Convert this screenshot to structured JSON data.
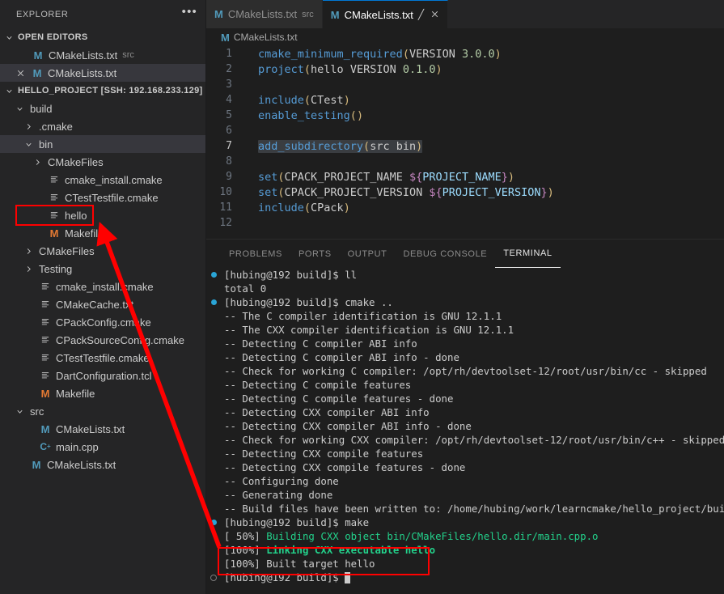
{
  "window": {
    "app": "Visual Studio Code",
    "theme_bg": "#1e1e1e",
    "accent": "#0078d4",
    "annotation_color": "#ff0000"
  },
  "sidebar": {
    "title": "EXPLORER",
    "more_actions": "•••",
    "open_editors": {
      "label": "OPEN EDITORS",
      "expanded": true,
      "items": [
        {
          "name": "CMakeLists.txt",
          "description": "src",
          "icon": "markdown-file-icon",
          "selected": false,
          "has_close": false
        },
        {
          "name": "CMakeLists.txt",
          "description": "",
          "icon": "markdown-file-icon",
          "selected": true,
          "has_close": true
        }
      ]
    },
    "workspace": {
      "label": "HELLO_PROJECT [SSH: 192.168.233.129]",
      "expanded": true,
      "tree": [
        {
          "name": "build",
          "type": "folder",
          "depth": 1,
          "expanded": true,
          "icon": "chevron-down-icon"
        },
        {
          "name": ".cmake",
          "type": "folder",
          "depth": 2,
          "expanded": false,
          "icon": "chevron-right-icon"
        },
        {
          "name": "bin",
          "type": "folder",
          "depth": 2,
          "expanded": true,
          "icon": "chevron-down-icon",
          "selected": true
        },
        {
          "name": "CMakeFiles",
          "type": "folder",
          "depth": 3,
          "expanded": false,
          "icon": "chevron-right-icon"
        },
        {
          "name": "cmake_install.cmake",
          "type": "file",
          "depth": 3,
          "icon": "config-file-icon"
        },
        {
          "name": "CTestTestfile.cmake",
          "type": "file",
          "depth": 3,
          "icon": "config-file-icon"
        },
        {
          "name": "hello",
          "type": "file",
          "depth": 3,
          "icon": "config-file-icon",
          "highlighted": true
        },
        {
          "name": "Makefile",
          "type": "file",
          "depth": 3,
          "icon": "makefile-icon"
        },
        {
          "name": "CMakeFiles",
          "type": "folder",
          "depth": 2,
          "expanded": false,
          "icon": "chevron-right-icon"
        },
        {
          "name": "Testing",
          "type": "folder",
          "depth": 2,
          "expanded": false,
          "icon": "chevron-right-icon"
        },
        {
          "name": "cmake_install.cmake",
          "type": "file",
          "depth": 2,
          "icon": "config-file-icon"
        },
        {
          "name": "CMakeCache.txt",
          "type": "file",
          "depth": 2,
          "icon": "config-file-icon"
        },
        {
          "name": "CPackConfig.cmake",
          "type": "file",
          "depth": 2,
          "icon": "config-file-icon"
        },
        {
          "name": "CPackSourceConfig.cmake",
          "type": "file",
          "depth": 2,
          "icon": "config-file-icon"
        },
        {
          "name": "CTestTestfile.cmake",
          "type": "file",
          "depth": 2,
          "icon": "config-file-icon"
        },
        {
          "name": "DartConfiguration.tcl",
          "type": "file",
          "depth": 2,
          "icon": "config-file-icon"
        },
        {
          "name": "Makefile",
          "type": "file",
          "depth": 2,
          "icon": "makefile-icon"
        },
        {
          "name": "src",
          "type": "folder",
          "depth": 1,
          "expanded": true,
          "icon": "chevron-down-icon"
        },
        {
          "name": "CMakeLists.txt",
          "type": "file",
          "depth": 2,
          "icon": "markdown-file-icon"
        },
        {
          "name": "main.cpp",
          "type": "file",
          "depth": 2,
          "icon": "cpp-file-icon"
        },
        {
          "name": "CMakeLists.txt",
          "type": "file",
          "depth": 1,
          "icon": "markdown-file-icon"
        }
      ]
    }
  },
  "editor": {
    "tabs": [
      {
        "label": "CMakeLists.txt",
        "description": "src",
        "active": false,
        "dirty": false,
        "closable": false,
        "icon": "markdown-file-icon"
      },
      {
        "label": "CMakeLists.txt",
        "description": "",
        "active": true,
        "dirty": true,
        "dirty_mark": "╱",
        "closable": true,
        "icon": "markdown-file-icon"
      }
    ],
    "breadcrumb": {
      "icon": "markdown-file-icon",
      "path": "CMakeLists.txt"
    },
    "lines": [
      {
        "n": "1",
        "tokens": [
          {
            "t": "cmake_minimum_required",
            "c": "fn"
          },
          {
            "t": "(",
            "c": "par"
          },
          {
            "t": "VERSION",
            "c": "arg"
          },
          {
            "t": " ",
            "c": "plain"
          },
          {
            "t": "3.0.0",
            "c": "num"
          },
          {
            "t": ")",
            "c": "par"
          }
        ]
      },
      {
        "n": "2",
        "tokens": [
          {
            "t": "project",
            "c": "fn"
          },
          {
            "t": "(",
            "c": "par"
          },
          {
            "t": "hello VERSION ",
            "c": "arg"
          },
          {
            "t": "0.1.0",
            "c": "num"
          },
          {
            "t": ")",
            "c": "par"
          }
        ]
      },
      {
        "n": "3",
        "tokens": []
      },
      {
        "n": "4",
        "tokens": [
          {
            "t": "include",
            "c": "fn"
          },
          {
            "t": "(",
            "c": "par"
          },
          {
            "t": "CTest",
            "c": "arg"
          },
          {
            "t": ")",
            "c": "par"
          }
        ]
      },
      {
        "n": "5",
        "tokens": [
          {
            "t": "enable_testing",
            "c": "fn"
          },
          {
            "t": "(",
            "c": "par"
          },
          {
            "t": ")",
            "c": "par"
          }
        ]
      },
      {
        "n": "6",
        "tokens": []
      },
      {
        "n": "7",
        "highlight": true,
        "current": true,
        "tokens": [
          {
            "t": "add_subdirectory",
            "c": "fn"
          },
          {
            "t": "(",
            "c": "par"
          },
          {
            "t": "src bin",
            "c": "arg"
          },
          {
            "t": ")",
            "c": "par"
          }
        ]
      },
      {
        "n": "8",
        "tokens": []
      },
      {
        "n": "9",
        "tokens": [
          {
            "t": "set",
            "c": "fn"
          },
          {
            "t": "(",
            "c": "par"
          },
          {
            "t": "CPACK_PROJECT_NAME ",
            "c": "arg"
          },
          {
            "t": "${",
            "c": "dol"
          },
          {
            "t": "PROJECT_NAME",
            "c": "var"
          },
          {
            "t": "}",
            "c": "dol"
          },
          {
            "t": ")",
            "c": "par"
          }
        ]
      },
      {
        "n": "10",
        "tokens": [
          {
            "t": "set",
            "c": "fn"
          },
          {
            "t": "(",
            "c": "par"
          },
          {
            "t": "CPACK_PROJECT_VERSION ",
            "c": "arg"
          },
          {
            "t": "${",
            "c": "dol"
          },
          {
            "t": "PROJECT_VERSION",
            "c": "var"
          },
          {
            "t": "}",
            "c": "dol"
          },
          {
            "t": ")",
            "c": "par"
          }
        ]
      },
      {
        "n": "11",
        "tokens": [
          {
            "t": "include",
            "c": "fn"
          },
          {
            "t": "(",
            "c": "par"
          },
          {
            "t": "CPack",
            "c": "arg"
          },
          {
            "t": ")",
            "c": "par"
          }
        ]
      },
      {
        "n": "12",
        "tokens": []
      }
    ]
  },
  "panel": {
    "tabs": [
      {
        "label": "PROBLEMS",
        "active": false
      },
      {
        "label": "PORTS",
        "active": false
      },
      {
        "label": "OUTPUT",
        "active": false
      },
      {
        "label": "DEBUG CONSOLE",
        "active": false
      },
      {
        "label": "TERMINAL",
        "active": true
      }
    ],
    "terminal_lines": [
      {
        "deco": "command",
        "text": "[hubing@192 build]$ ll"
      },
      {
        "deco": "none",
        "text": "total 0"
      },
      {
        "deco": "command",
        "text": "[hubing@192 build]$ cmake .."
      },
      {
        "deco": "none",
        "text": "-- The C compiler identification is GNU 12.1.1"
      },
      {
        "deco": "none",
        "text": "-- The CXX compiler identification is GNU 12.1.1"
      },
      {
        "deco": "none",
        "text": "-- Detecting C compiler ABI info"
      },
      {
        "deco": "none",
        "text": "-- Detecting C compiler ABI info - done"
      },
      {
        "deco": "none",
        "text": "-- Check for working C compiler: /opt/rh/devtoolset-12/root/usr/bin/cc - skipped"
      },
      {
        "deco": "none",
        "text": "-- Detecting C compile features"
      },
      {
        "deco": "none",
        "text": "-- Detecting C compile features - done"
      },
      {
        "deco": "none",
        "text": "-- Detecting CXX compiler ABI info"
      },
      {
        "deco": "none",
        "text": "-- Detecting CXX compiler ABI info - done"
      },
      {
        "deco": "none",
        "text": "-- Check for working CXX compiler: /opt/rh/devtoolset-12/root/usr/bin/c++ - skipped"
      },
      {
        "deco": "none",
        "text": "-- Detecting CXX compile features"
      },
      {
        "deco": "none",
        "text": "-- Detecting CXX compile features - done"
      },
      {
        "deco": "none",
        "text": "-- Configuring done"
      },
      {
        "deco": "none",
        "text": "-- Generating done"
      },
      {
        "deco": "none",
        "text": "-- Build files have been written to: /home/hubing/work/learncmake/hello_project/build"
      },
      {
        "deco": "command",
        "text": "[hubing@192 build]$ make"
      },
      {
        "deco": "none",
        "prefix": "[ 50%] ",
        "text": "Building CXX object bin/CMakeFiles/hello.dir/main.cpp.o",
        "color": "green"
      },
      {
        "deco": "none",
        "prefix": "[100%] ",
        "text": "Linking CXX executable hello",
        "color": "green",
        "bold": true
      },
      {
        "deco": "none",
        "text": "[100%] Built target hello"
      },
      {
        "deco": "prompt",
        "text": "[hubing@192 build]$ ",
        "cursor": true
      }
    ]
  },
  "annotations": {
    "box_hello_label": "highlight-box-hello-file",
    "box_terminal_label": "highlight-box-build-output",
    "arrow_label": "pointer-arrow-to-hello-file"
  }
}
